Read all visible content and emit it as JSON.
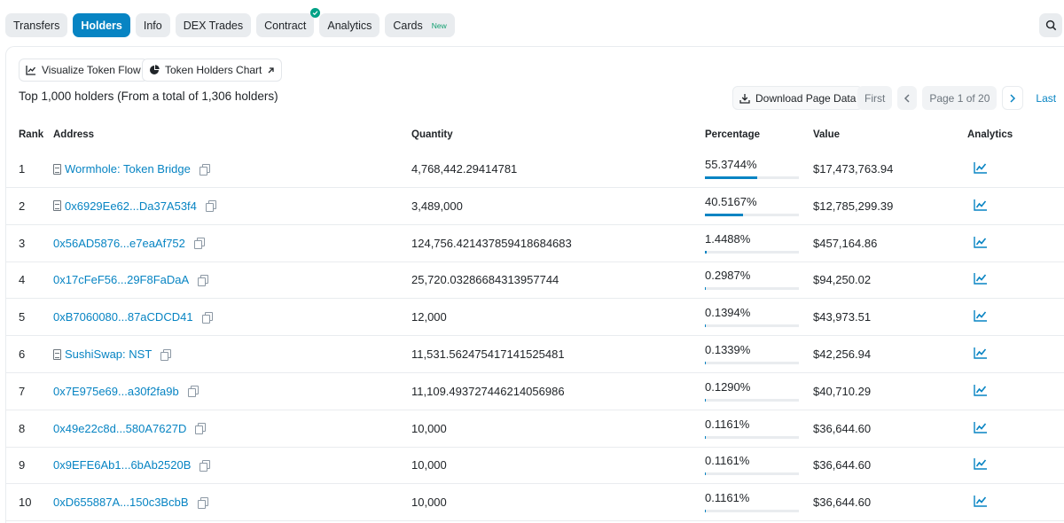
{
  "tabs": [
    {
      "label": "Transfers",
      "active": false
    },
    {
      "label": "Holders",
      "active": true
    },
    {
      "label": "Info",
      "active": false
    },
    {
      "label": "DEX Trades",
      "active": false
    },
    {
      "label": "Contract",
      "active": false,
      "verified": true
    },
    {
      "label": "Analytics",
      "active": false
    },
    {
      "label": "Cards",
      "active": false,
      "badge": "New"
    }
  ],
  "toolbar": {
    "visualize_label": "Visualize Token Flow",
    "chart_label": "Token Holders Chart"
  },
  "summary": "Top 1,000 holders (From a total of 1,306 holders)",
  "download_label": "Download Page Data",
  "pager": {
    "first": "First",
    "page": "Page 1 of 20",
    "last": "Last"
  },
  "columns": {
    "rank": "Rank",
    "address": "Address",
    "quantity": "Quantity",
    "percentage": "Percentage",
    "value": "Value",
    "analytics": "Analytics"
  },
  "colors": {
    "accent": "#0784c3",
    "verified": "#00a186"
  },
  "rows": [
    {
      "rank": "1",
      "address": "Wormhole: Token Bridge",
      "contract": true,
      "quantity": "4,768,442.29414781",
      "percentage": "55.3744%",
      "pct": 55.3744,
      "value": "$17,473,763.94"
    },
    {
      "rank": "2",
      "address": "0x6929Ee62...Da37A53f4",
      "contract": true,
      "quantity": "3,489,000",
      "percentage": "40.5167%",
      "pct": 40.5167,
      "value": "$12,785,299.39"
    },
    {
      "rank": "3",
      "address": "0x56AD5876...e7eaAf752",
      "contract": false,
      "quantity": "124,756.421437859418684683",
      "percentage": "1.4488%",
      "pct": 1.4488,
      "value": "$457,164.86"
    },
    {
      "rank": "4",
      "address": "0x17cFeF56...29F8FaDaA",
      "contract": false,
      "quantity": "25,720.03286684313957744",
      "percentage": "0.2987%",
      "pct": 0.2987,
      "value": "$94,250.02"
    },
    {
      "rank": "5",
      "address": "0xB7060080...87aCDCD41",
      "contract": false,
      "quantity": "12,000",
      "percentage": "0.1394%",
      "pct": 0.1394,
      "value": "$43,973.51"
    },
    {
      "rank": "6",
      "address": "SushiSwap: NST",
      "contract": true,
      "quantity": "11,531.562475417141525481",
      "percentage": "0.1339%",
      "pct": 0.1339,
      "value": "$42,256.94"
    },
    {
      "rank": "7",
      "address": "0x7E975e69...a30f2fa9b",
      "contract": false,
      "quantity": "11,109.493727446214056986",
      "percentage": "0.1290%",
      "pct": 0.129,
      "value": "$40,710.29"
    },
    {
      "rank": "8",
      "address": "0x49e22c8d...580A7627D",
      "contract": false,
      "quantity": "10,000",
      "percentage": "0.1161%",
      "pct": 0.1161,
      "value": "$36,644.60"
    },
    {
      "rank": "9",
      "address": "0x9EFE6Ab1...6bAb2520B",
      "contract": false,
      "quantity": "10,000",
      "percentage": "0.1161%",
      "pct": 0.1161,
      "value": "$36,644.60"
    },
    {
      "rank": "10",
      "address": "0xD655887A...150c3BcbB",
      "contract": false,
      "quantity": "10,000",
      "percentage": "0.1161%",
      "pct": 0.1161,
      "value": "$36,644.60"
    }
  ]
}
